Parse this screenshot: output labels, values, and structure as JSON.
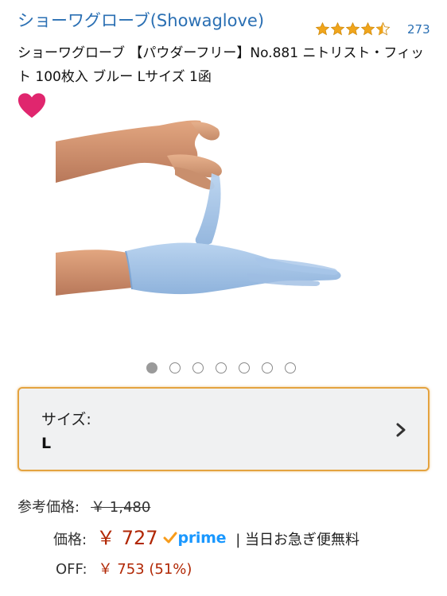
{
  "header": {
    "brand": "ショーワグローブ(Showaglove)",
    "rating_stars": 4.5,
    "review_count": "273",
    "title": "ショーワグローブ 【パウダーフリー】No.881 ニトリスト・フィット 100枚入 ブルー Lサイズ 1函"
  },
  "icons": {
    "favorite": "heart-icon",
    "chevron": "chevron-right-icon",
    "prime": "prime-check-icon"
  },
  "colors": {
    "link": "#2a6fb3",
    "star": "#f0a51c",
    "heart": "#e0266e",
    "price": "#b12704",
    "prime": "#1a98ff",
    "selector_border": "#e4a340"
  },
  "carousel": {
    "total": 7,
    "active_index": 0
  },
  "size_selector": {
    "label": "サイズ:",
    "value": "L"
  },
  "pricing": {
    "list_label": "参考価格:",
    "list_price": "￥ 1,480",
    "price_label": "価格:",
    "price": "￥ 727",
    "prime_label": "prime",
    "delivery": "| 当日お急ぎ便無料",
    "off_label": "OFF:",
    "savings": "￥ 753 (51%)"
  }
}
